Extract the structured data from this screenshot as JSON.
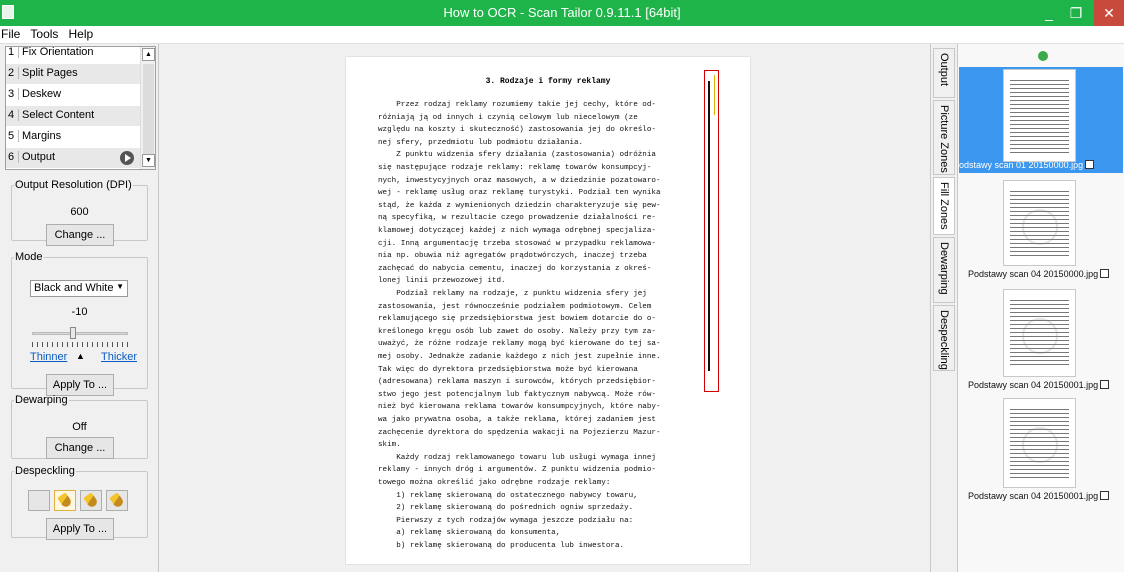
{
  "window": {
    "title": "How to OCR - Scan Tailor 0.9.11.1 [64bit]",
    "minimize": "_",
    "maximize": "❐",
    "close": "✕"
  },
  "menu": {
    "items": [
      "File",
      "Tools",
      "Help"
    ]
  },
  "stages": [
    {
      "num": "1",
      "label": "Fix Orientation"
    },
    {
      "num": "2",
      "label": "Split Pages"
    },
    {
      "num": "3",
      "label": "Deskew"
    },
    {
      "num": "4",
      "label": "Select Content"
    },
    {
      "num": "5",
      "label": "Margins"
    },
    {
      "num": "6",
      "label": "Output"
    }
  ],
  "output_resolution": {
    "legend": "Output Resolution (DPI)",
    "value": "600",
    "change_label": "Change ..."
  },
  "mode": {
    "legend": "Mode",
    "selected": "Black and White",
    "threshold_value": "-10",
    "threshold_level": -10,
    "thinner_label": "Thinner",
    "thicker_label": "Thicker",
    "apply_label": "Apply To ..."
  },
  "dewarping": {
    "legend": "Dewarping",
    "value": "Off",
    "change_label": "Change ..."
  },
  "despeckling": {
    "legend": "Despeckling",
    "apply_label": "Apply To ..."
  },
  "tabs": [
    "Output",
    "Picture Zones",
    "Fill Zones",
    "Dewarping",
    "Despeckling"
  ],
  "document": {
    "heading": "3. Rodzaje i formy reklamy",
    "lines": [
      "    Przez rodzaj reklamy rozumiemy takie jej cechy, które od-",
      "różniają ją od innych i czynią celowym lub niecelowym (ze",
      "względu na koszty i skuteczność) zastosowania jej do określo-",
      "nej sfery, przedmiotu lub podmiotu działania.",
      "    Z punktu widzenia sfery działania (zastosowania) odróżnia",
      "się następujące rodzaje reklamy: reklamę towarów konsumpcyj-",
      "nych, inwestycyjnych oraz masowych, a w dziedzinie pozatowaro-",
      "wej - reklamę usług oraz reklamę turystyki. Podział ten wynika",
      "stąd, że każda z wymienionych dziedzin charakteryzuje się pew-",
      "ną specyfiką, w rezultacie czego prowadzenie działalności re-",
      "klamowej dotyczącej każdej z nich wymaga odrębnej specjaliza-",
      "cji. Inną argumentację trzeba stosować w przypadku reklamowa-",
      "nia np. obuwia niż agregatów prądotwórczych, inaczej trzeba",
      "zachęcać do nabycia cementu, inaczej do korzystania z okreś-",
      "lonej linii przewozowej itd.",
      "    Podział reklamy na rodzaje, z punktu widzenia sfery jej",
      "zastosowania, jest równocześnie podziałem podmiotowym. Celem",
      "reklamującego się przedsiębiorstwa jest bowiem dotarcie do o-",
      "kreślonego kręgu osób lub zawet do osoby. Należy przy tym za-",
      "uważyć, że różne rodzaje reklamy mogą być kierowane do tej sa-",
      "mej osoby. Jednakże zadanie każdego z nich jest zupełnie inne.",
      "Tak więc do dyrektora przedsiębiorstwa może być kierowana",
      "(adresowana) reklama maszyn i surowców, których przedsiębior-",
      "stwo jego jest potencjalnym lub faktycznym nabywcą. Może rów-",
      "nież być kierowana reklama towarów konsumpcyjnych, które naby-",
      "wa jako prywatna osoba, a także reklama, której zadaniem jest",
      "zachęcenie dyrektora do spędzenia wakacji na Pojezierzu Mazur-",
      "skim.",
      "    Każdy rodzaj reklamowanego towaru lub usługi wymaga innej",
      "reklamy - innych dróg i argumentów. Z punktu widzenia podmio-",
      "towego można określić jako odrębne rodzaje reklamy:",
      "    1) reklamę skierowaną do ostatecznego nabywcy towaru,",
      "    2) reklamę skierowaną do pośrednich ogniw sprzedaży.",
      "    Pierwszy z tych rodzajów wymaga jeszcze podziału na:",
      "    a) reklamę skierowaną do konsumenta,",
      "    b) reklamę skierowaną do producenta lub inwestora."
    ]
  },
  "thumbnails": [
    {
      "caption": "odstawy scan 01 20150000.jpg",
      "selected": true
    },
    {
      "caption": "Podstawy scan 04 20150000.jpg",
      "selected": false
    },
    {
      "caption": "Podstawy scan 04 20150001.jpg",
      "selected": false
    },
    {
      "caption": "Podstawy scan 04 20150001.jpg",
      "selected": false
    }
  ]
}
